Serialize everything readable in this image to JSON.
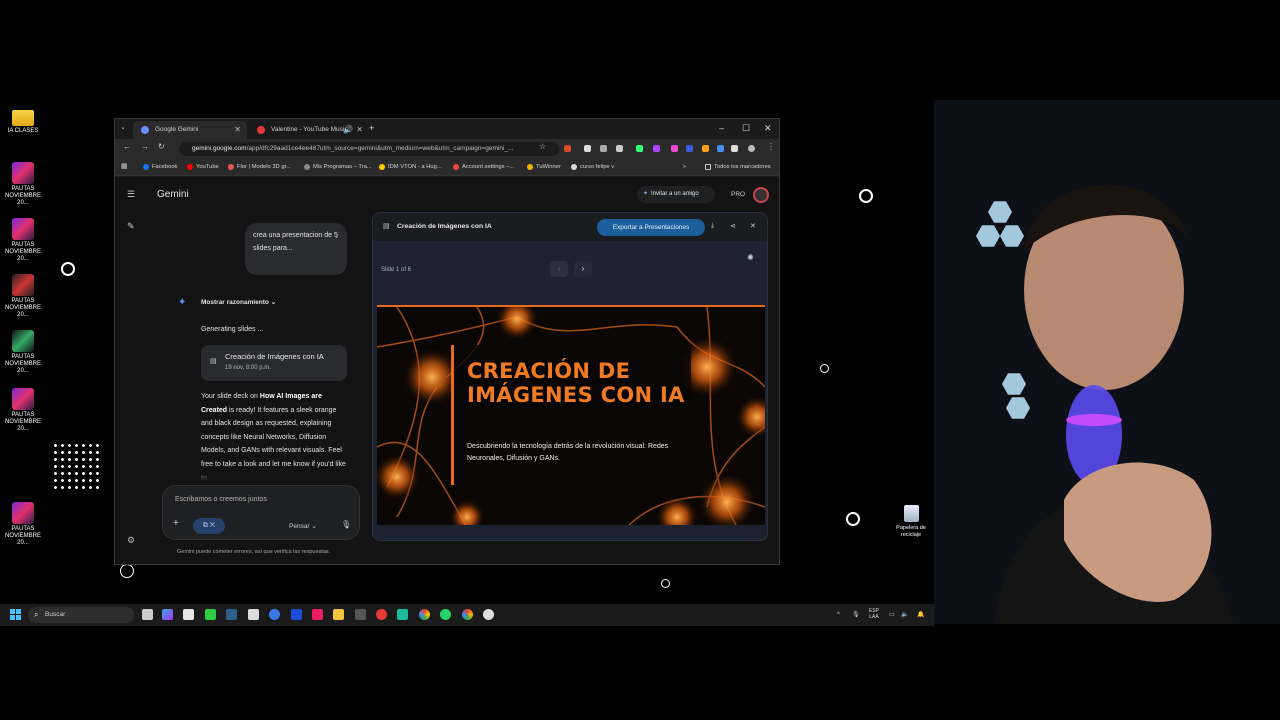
{
  "desktop": {
    "icons": [
      {
        "label": "IA CLASES"
      },
      {
        "label": "PAUTAS NOVIEMBRE 20..."
      },
      {
        "label": "PAUTAS NOVIEMBRE 20..."
      },
      {
        "label": "PAUTAS NOVIEMBRE 20..."
      },
      {
        "label": "PAUTAS NOVIEMBRE 20..."
      },
      {
        "label": "PAUTAS NOVIEMBRE 20..."
      },
      {
        "label": "PAUTAS NOVIEMBRE 20..."
      }
    ],
    "recycle_bin": "Papelera de reciclaje"
  },
  "browser": {
    "tabs": [
      {
        "label": "Google Gemini",
        "active": true
      },
      {
        "label": "Valentine - YouTube Music",
        "active": false
      }
    ],
    "url_host": "gemini.google.com",
    "url_path": "/app/dfc29aad1ce4ee487utm_source=gemini&utm_medium=web&utm_campaign=gemini_...",
    "bookmarks": [
      "Facebook",
      "YouTube",
      "Flor | Modelo 3D gr...",
      "Mis Programas – Tra...",
      "IDM VTON - a Hug...",
      "Account settings –...",
      "TuWinner",
      "curso felipe v"
    ],
    "all_bookmarks": "Todos los marcadores"
  },
  "gemini": {
    "title": "Gemini",
    "invite_label": "Invitar a un amigo",
    "pro_label": "PRO",
    "user_message": "crea una presentacion de 5 slides para...",
    "reasoning_label": "Mostrar razonamiento",
    "generating": "Generating slides ...",
    "chip_title": "Creación de Imágenes con IA",
    "chip_date": "19 nov, 8:00 p.m.",
    "response_pre": "Your slide deck on ",
    "response_bold": "How AI Images are Created",
    "response_post": " is ready! It features a sleek orange and black design as requested, explaining concepts like Neural Networks, Diffusion Models, and GANs with relevant visuals. Feel free to take a look and let me know if you'd like to",
    "composer_placeholder": "Escribamos o creemos juntos",
    "think_label": "Pensar",
    "disclaimer": "Gemini puede cometer errores, así que verifica las respuestas."
  },
  "canvas": {
    "title": "Creación de Imágenes con IA",
    "export_label": "Exportar a Presentaciones",
    "slide_counter": "Slide 1 of 6",
    "slide_title": "CREACIÓN DE IMÁGENES CON IA",
    "slide_subtitle": "Descubriendo la tecnología detrás de la revolución visual: Redes Neuronales, Difusión y GANs."
  },
  "taskbar": {
    "search_placeholder": "Buscar",
    "lang_top": "ESP",
    "lang_bottom": "LAA"
  },
  "colors": {
    "accent_orange": "#f07a22",
    "export_blue": "#1c5f9a",
    "gemini_bg": "#131314"
  }
}
